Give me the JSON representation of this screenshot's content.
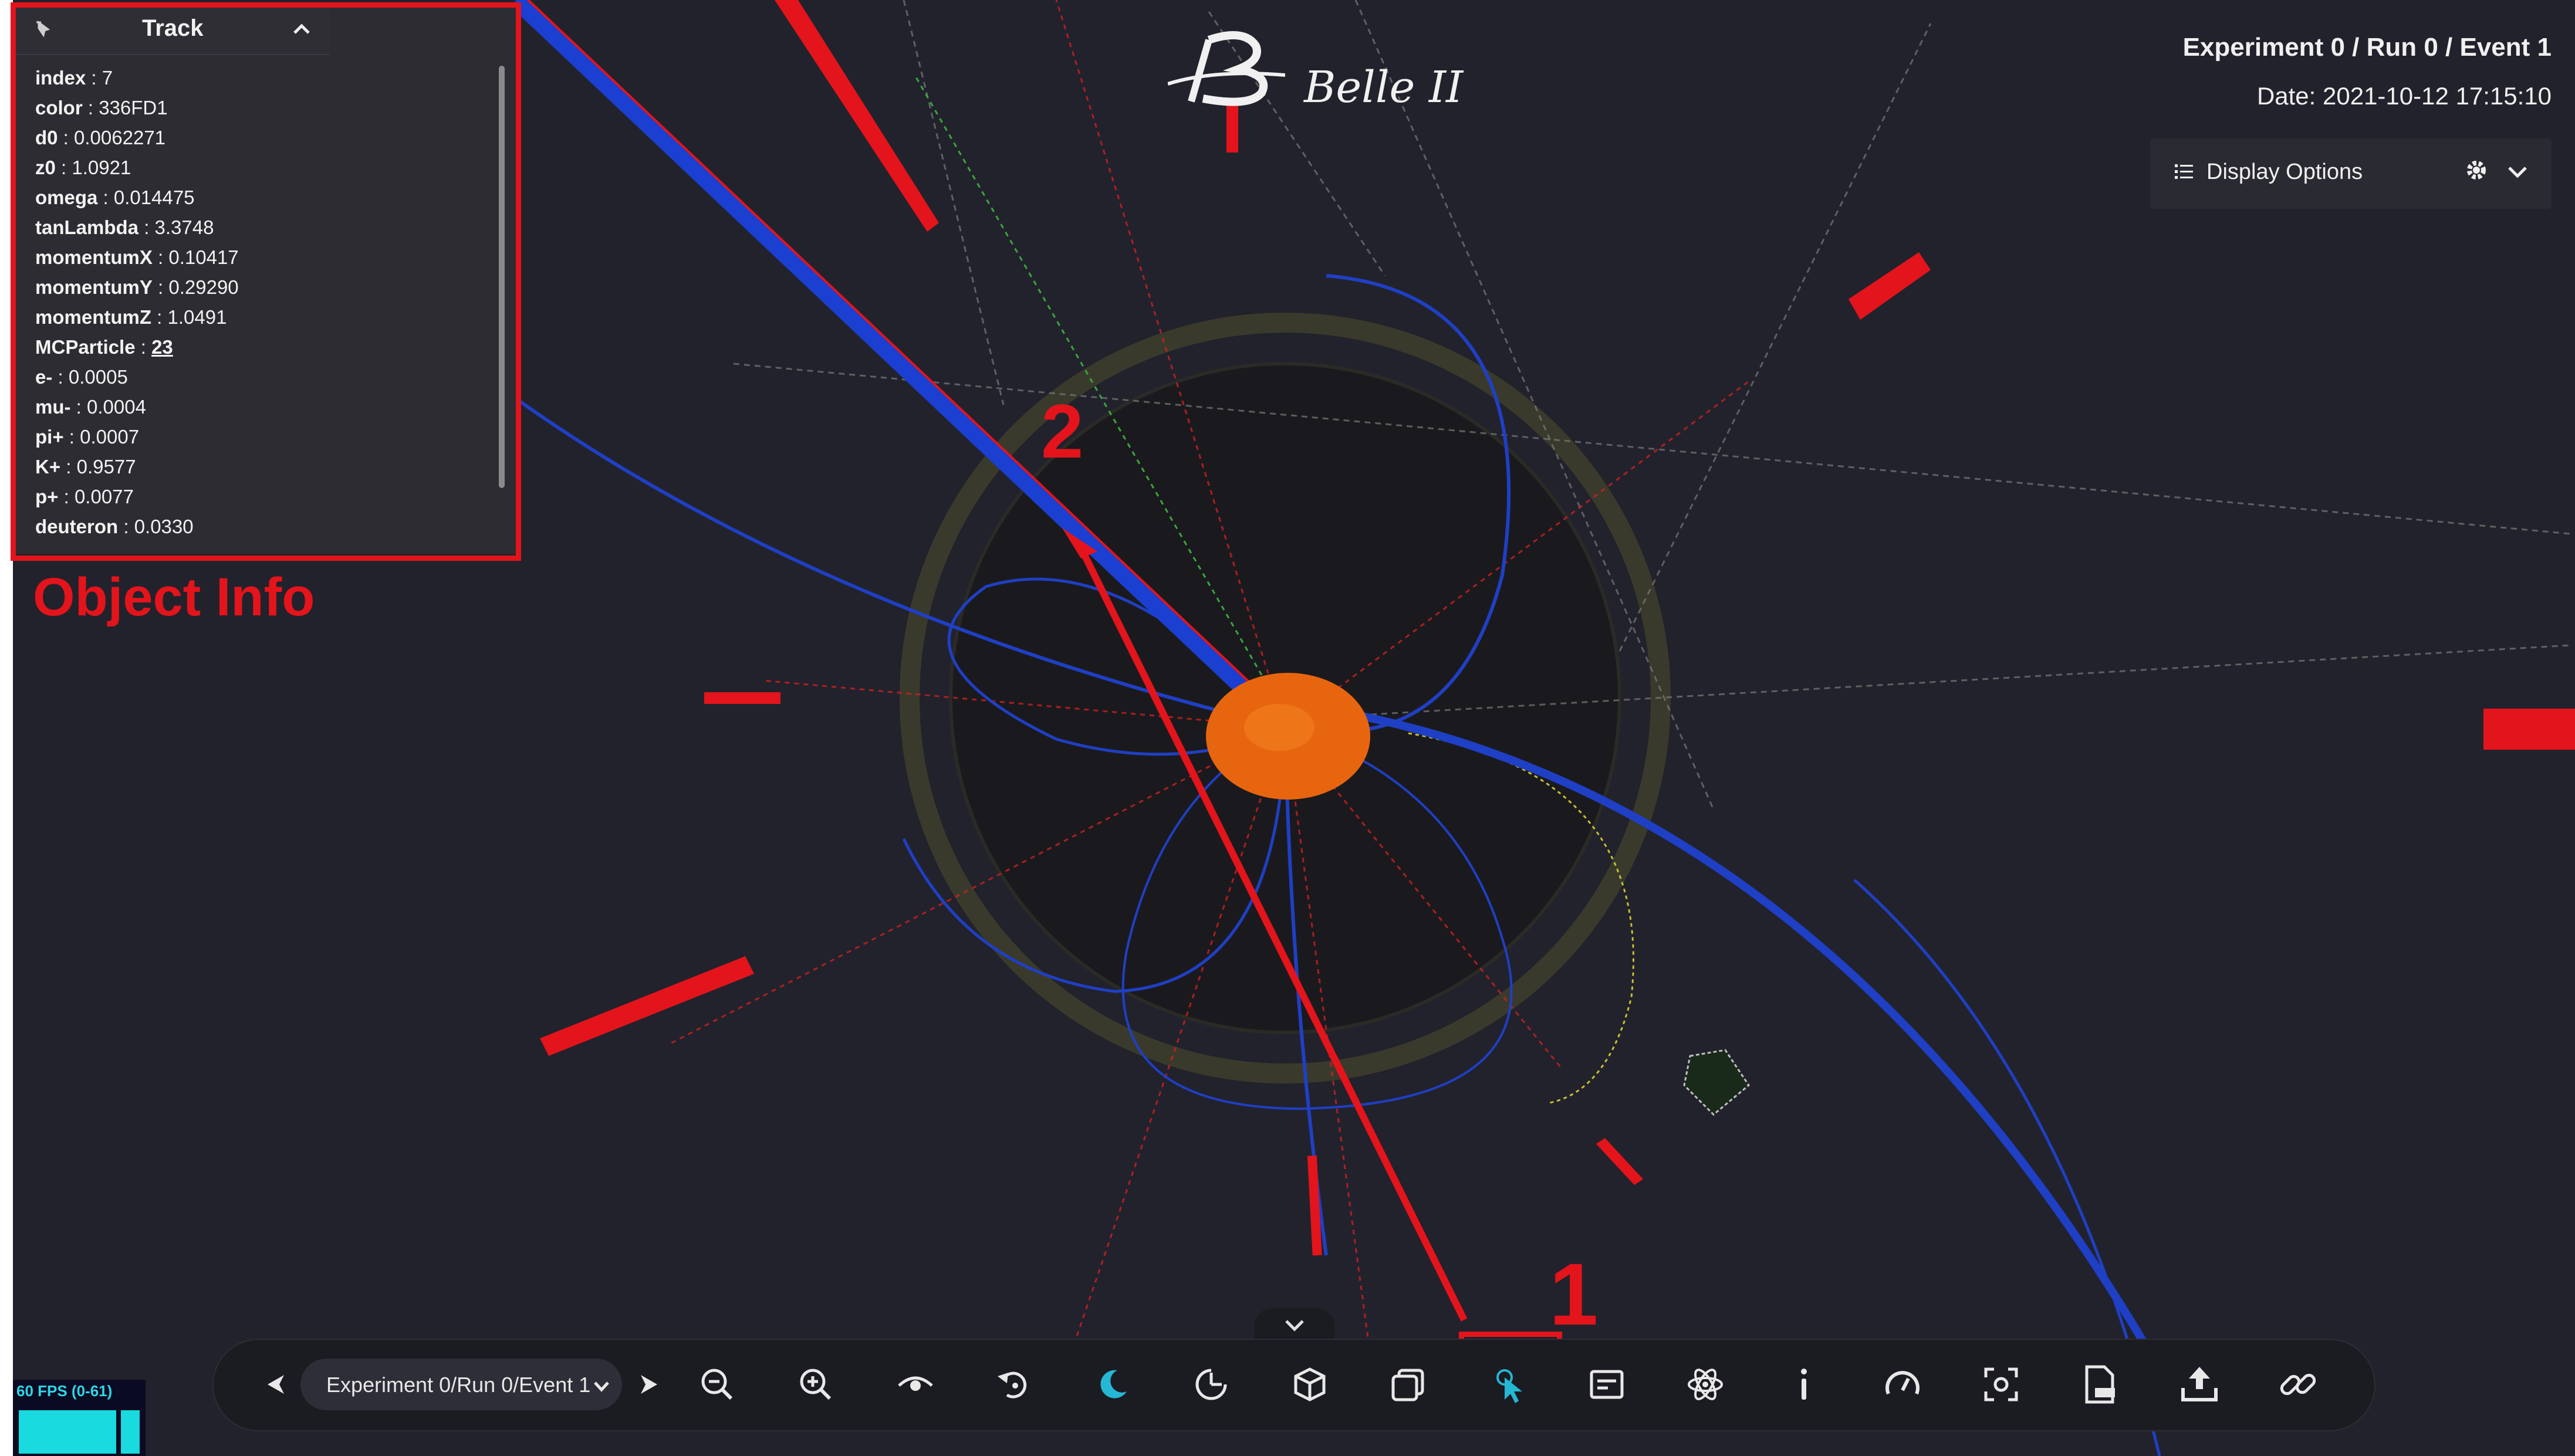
{
  "app": {
    "logo_text": "Belle II",
    "logo_mark": "belle-b-logo"
  },
  "header": {
    "experiment_title": "Experiment 0 / Run 0 / Event 1",
    "date": "Date: 2021-10-12 17:15:10"
  },
  "display_options": {
    "label": "Display Options",
    "icons": [
      "list-icon",
      "gear-icon",
      "chevron-down-icon"
    ]
  },
  "object_panel": {
    "title": "Track",
    "rows": [
      {
        "key": "index",
        "value": "7"
      },
      {
        "key": "color",
        "value": "336FD1"
      },
      {
        "key": "d0",
        "value": "0.0062271"
      },
      {
        "key": "z0",
        "value": "1.0921"
      },
      {
        "key": "omega",
        "value": "0.014475"
      },
      {
        "key": "tanLambda",
        "value": "3.3748"
      },
      {
        "key": "momentumX",
        "value": "0.10417"
      },
      {
        "key": "momentumY",
        "value": "0.29290"
      },
      {
        "key": "momentumZ",
        "value": "1.0491"
      },
      {
        "key": "MCParticle",
        "value": "23"
      },
      {
        "key": "e-",
        "value": "0.0005"
      },
      {
        "key": "mu-",
        "value": "0.0004"
      },
      {
        "key": "pi+",
        "value": "0.0007"
      },
      {
        "key": "K+",
        "value": "0.9577"
      },
      {
        "key": "p+",
        "value": "0.0077"
      },
      {
        "key": "deuteron",
        "value": "0.0330"
      }
    ]
  },
  "annotations": {
    "object_info_label": "Object Info",
    "marker_1": "1",
    "marker_2": "2",
    "color": "#e3141b"
  },
  "toolbar": {
    "event_select_value": "Experiment 0/Run 0/Event 1",
    "buttons": [
      "previous-event",
      "next-event",
      "zoom-out",
      "zoom-in",
      "view-options",
      "auto-rotate",
      "dark-theme",
      "clipping",
      "geometry-toggle",
      "overlay-view",
      "object-selection",
      "info-panel",
      "experiment-info",
      "event-data-info",
      "performance-mode",
      "screenshot",
      "export-png",
      "export",
      "share-link"
    ],
    "active_button": "object-selection",
    "accent_color": "#25b7d3"
  },
  "fps": {
    "label": "60 FPS (0-61)"
  },
  "colors": {
    "background": "#22222c",
    "track_blue": "#1f3fc4",
    "cluster_red": "#e3141b",
    "vertex_orange": "#e8650f"
  }
}
